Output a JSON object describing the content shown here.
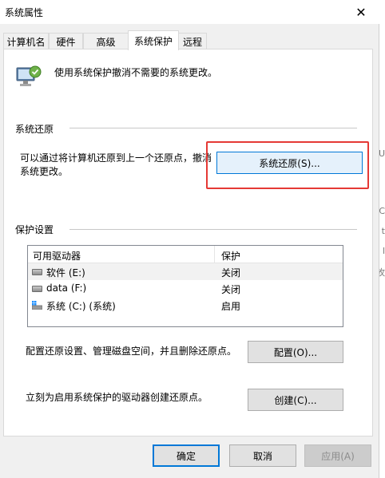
{
  "window": {
    "title": "系统属性",
    "close_glyph": "✕"
  },
  "tabs": [
    {
      "label": "计算机名"
    },
    {
      "label": "硬件"
    },
    {
      "label": "高级"
    },
    {
      "label": "系统保护"
    },
    {
      "label": "远程"
    }
  ],
  "header": {
    "description": "使用系统保护撤消不需要的系统更改。"
  },
  "restore": {
    "group_label": "系统还原",
    "text_line1": "可以通过将计算机还原到上一个还原点，撤消",
    "text_line2": "系统更改。",
    "button_label": "系统还原(S)..."
  },
  "protection": {
    "group_label": "保护设置",
    "columns": [
      "可用驱动器",
      "保护"
    ],
    "drives": [
      {
        "name": "软件 (E:)",
        "status": "关闭",
        "icon": "drive-icon"
      },
      {
        "name": "data (F:)",
        "status": "关闭",
        "icon": "drive-icon"
      },
      {
        "name": "系统 (C:) (系统)",
        "status": "启用",
        "icon": "system-drive-icon"
      }
    ]
  },
  "configure": {
    "text": "配置还原设置、管理磁盘空间，并且删除还原点。",
    "button_label": "配置(O)..."
  },
  "create": {
    "text": "立刻为启用系统保护的驱动器创建还原点。",
    "button_label": "创建(C)..."
  },
  "footer": {
    "ok": "确定",
    "cancel": "取消",
    "apply": "应用(A)"
  },
  "background_fragments": [
    "C",
    "t",
    "l",
    "b",
    "U",
    "攸"
  ],
  "colors": {
    "accent": "#0078d7",
    "highlight_box": "#e53935"
  }
}
